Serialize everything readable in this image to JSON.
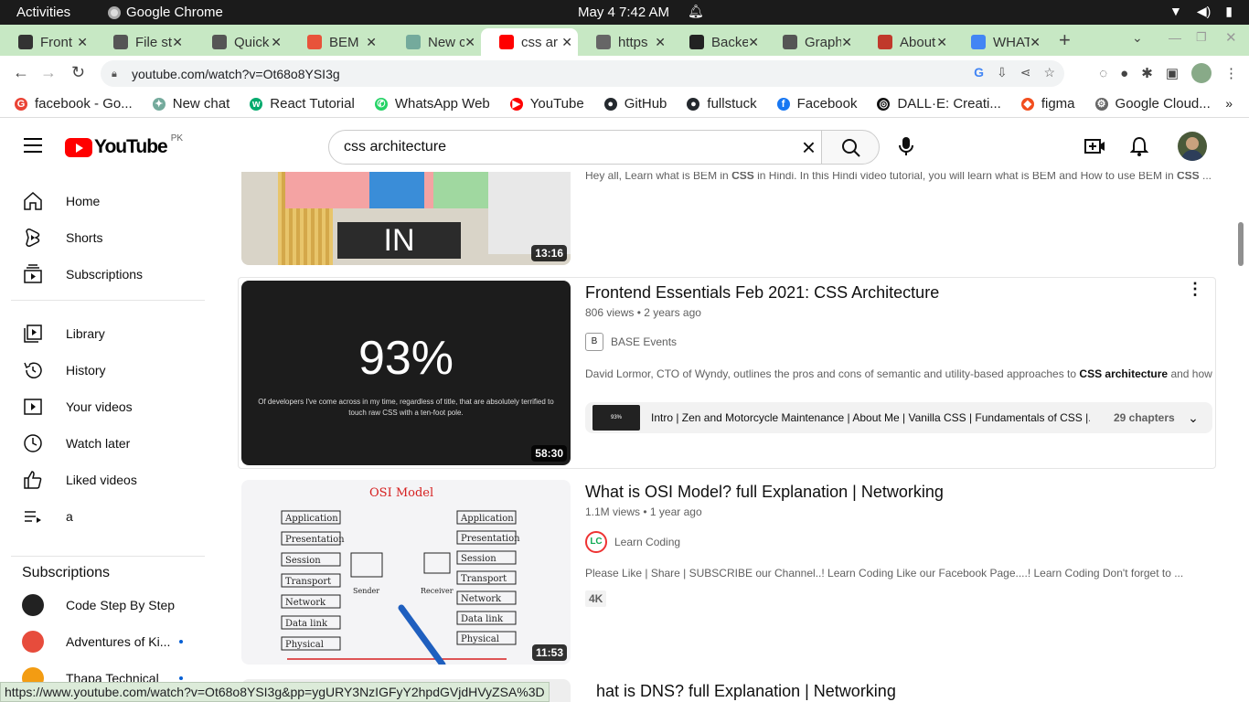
{
  "os": {
    "activities": "Activities",
    "app_name": "Google Chrome",
    "datetime": "May 4   7:42 AM"
  },
  "tabs": [
    {
      "title": "Front",
      "icon_color": "#333333",
      "icon": "frontend-icon"
    },
    {
      "title": "File st",
      "icon_color": "#555555",
      "icon": "file-icon"
    },
    {
      "title": "Quick",
      "icon_color": "#555555",
      "icon": "quick-icon"
    },
    {
      "title": "BEM",
      "icon_color": "#e8533a",
      "icon": "asterisk-icon"
    },
    {
      "title": "New c",
      "icon_color": "#74aa9c",
      "icon": "chatgpt-icon"
    },
    {
      "title": "css ar",
      "icon_color": "#ff0000",
      "icon": "youtube-icon",
      "active": true
    },
    {
      "title": "https",
      "icon_color": "#666666",
      "icon": "globe-icon"
    },
    {
      "title": "Backe",
      "icon_color": "#222222",
      "icon": "backend-icon"
    },
    {
      "title": "Graph",
      "icon_color": "#555555",
      "icon": "graph-icon"
    },
    {
      "title": "About",
      "icon_color": "#c0392b",
      "icon": "about-icon"
    },
    {
      "title": "WHAT",
      "icon_color": "#4285f4",
      "icon": "google-icon"
    }
  ],
  "address_bar": {
    "url": "youtube.com/watch?v=Ot68o8YSI3g"
  },
  "bookmarks": [
    {
      "label": "facebook - Go...",
      "icon": "google-icon",
      "color": "#ea4335",
      "glyph": "G"
    },
    {
      "label": "New chat",
      "icon": "chatgpt-icon",
      "color": "#74aa9c",
      "glyph": "✦"
    },
    {
      "label": "React Tutorial",
      "icon": "w3schools-icon",
      "color": "#04aa6d",
      "glyph": "w"
    },
    {
      "label": "WhatsApp Web",
      "icon": "whatsapp-icon",
      "color": "#25d366",
      "glyph": "✆"
    },
    {
      "label": "YouTube",
      "icon": "youtube-icon",
      "color": "#ff0000",
      "glyph": "▶"
    },
    {
      "label": "GitHub",
      "icon": "github-icon",
      "color": "#24292e",
      "glyph": "●"
    },
    {
      "label": "fullstuck",
      "icon": "github-icon",
      "color": "#24292e",
      "glyph": "●"
    },
    {
      "label": "Facebook",
      "icon": "facebook-icon",
      "color": "#1877f2",
      "glyph": "f"
    },
    {
      "label": "DALL·E: Creati...",
      "icon": "openai-icon",
      "color": "#111111",
      "glyph": "◎"
    },
    {
      "label": "figma",
      "icon": "figma-icon",
      "color": "#f24e1e",
      "glyph": "◆"
    },
    {
      "label": "Google Cloud...",
      "icon": "gcloud-icon",
      "color": "#666666",
      "glyph": "⚙"
    }
  ],
  "youtube": {
    "logo_text": "YouTube",
    "country_code": "PK",
    "search_query": "css architecture"
  },
  "sidebar": {
    "main": [
      {
        "label": "Home",
        "icon": "home-icon"
      },
      {
        "label": "Shorts",
        "icon": "shorts-icon"
      },
      {
        "label": "Subscriptions",
        "icon": "subscriptions-icon"
      }
    ],
    "library": [
      {
        "label": "Library",
        "icon": "library-icon"
      },
      {
        "label": "History",
        "icon": "history-icon"
      },
      {
        "label": "Your videos",
        "icon": "your-videos-icon"
      },
      {
        "label": "Watch later",
        "icon": "watch-later-icon"
      },
      {
        "label": "Liked videos",
        "icon": "liked-videos-icon"
      },
      {
        "label": "a",
        "icon": "playlist-icon"
      }
    ],
    "subscriptions_heading": "Subscriptions",
    "subscriptions": [
      {
        "label": "Code Step By Step",
        "color": "#222222",
        "new": false
      },
      {
        "label": "Adventures of Ki...",
        "color": "#e74c3c",
        "new": true
      },
      {
        "label": "Thapa Technical",
        "color": "#f39c12",
        "new": true
      }
    ]
  },
  "results": [
    {
      "description_plain_1": "Hey all, Learn what is BEM in ",
      "description_bold_1": "CSS",
      "description_plain_2": " in Hindi. In this Hindi video tutorial, you will learn what is BEM and How to use BEM in ",
      "description_bold_2": "CSS",
      "description_plain_3": " ...",
      "duration": "13:16",
      "thumb_text": "IN HINDI"
    },
    {
      "title": "Frontend Essentials Feb 2021: CSS Architecture",
      "views": "806 views",
      "age": "2 years ago",
      "channel": "BASE Events",
      "description_plain_1": "David Lormor, CTO of Wyndy, outlines the pros and cons of semantic and utility-based approaches to ",
      "description_bold_1": "CSS architecture",
      "description_plain_2": " and how ...",
      "duration": "58:30",
      "thumb_big": "93%",
      "thumb_caption": "Of developers I've come across in my time, regardless of title, that are absolutely terrified to touch raw CSS with a ten-foot pole.",
      "chapters_text": "Intro | Zen and Motorcycle Maintenance | About Me | Vanilla CSS | Fundamentals of CSS |...",
      "chapters_count": "29 chapters",
      "chapter_thumb": "93%"
    },
    {
      "title": "What is OSI Model? full Explanation | Networking",
      "views": "1.1M views",
      "age": "1 year ago",
      "channel": "Learn Coding",
      "channel_initials": "LC",
      "description": "Please Like | Share | SUBSCRIBE our Channel..! Learn Coding Like our Facebook Page....! Learn Coding Don't forget to ...",
      "badge": "4K",
      "duration": "11:53",
      "thumb_title": "OSI  Model",
      "layers_left": [
        "Application",
        "Presentation",
        "Session",
        "Transport",
        "Network",
        "Data link",
        "Physical"
      ],
      "layers_right": [
        "Application",
        "Presentation",
        "Session",
        "Transport",
        "Network",
        "Data link",
        "Physical"
      ],
      "sender": "Sender",
      "receiver": "Receiver"
    },
    {
      "title": "What is DNS? full Explanation | Networking",
      "title_visible": "hat is DNS? full Explanation | Networking"
    }
  ],
  "status_url": "https://www.youtube.com/watch?v=Ot68o8YSI3g&pp=ygURY3NzIGFyY2hpdGVjdHVyZSA%3D"
}
